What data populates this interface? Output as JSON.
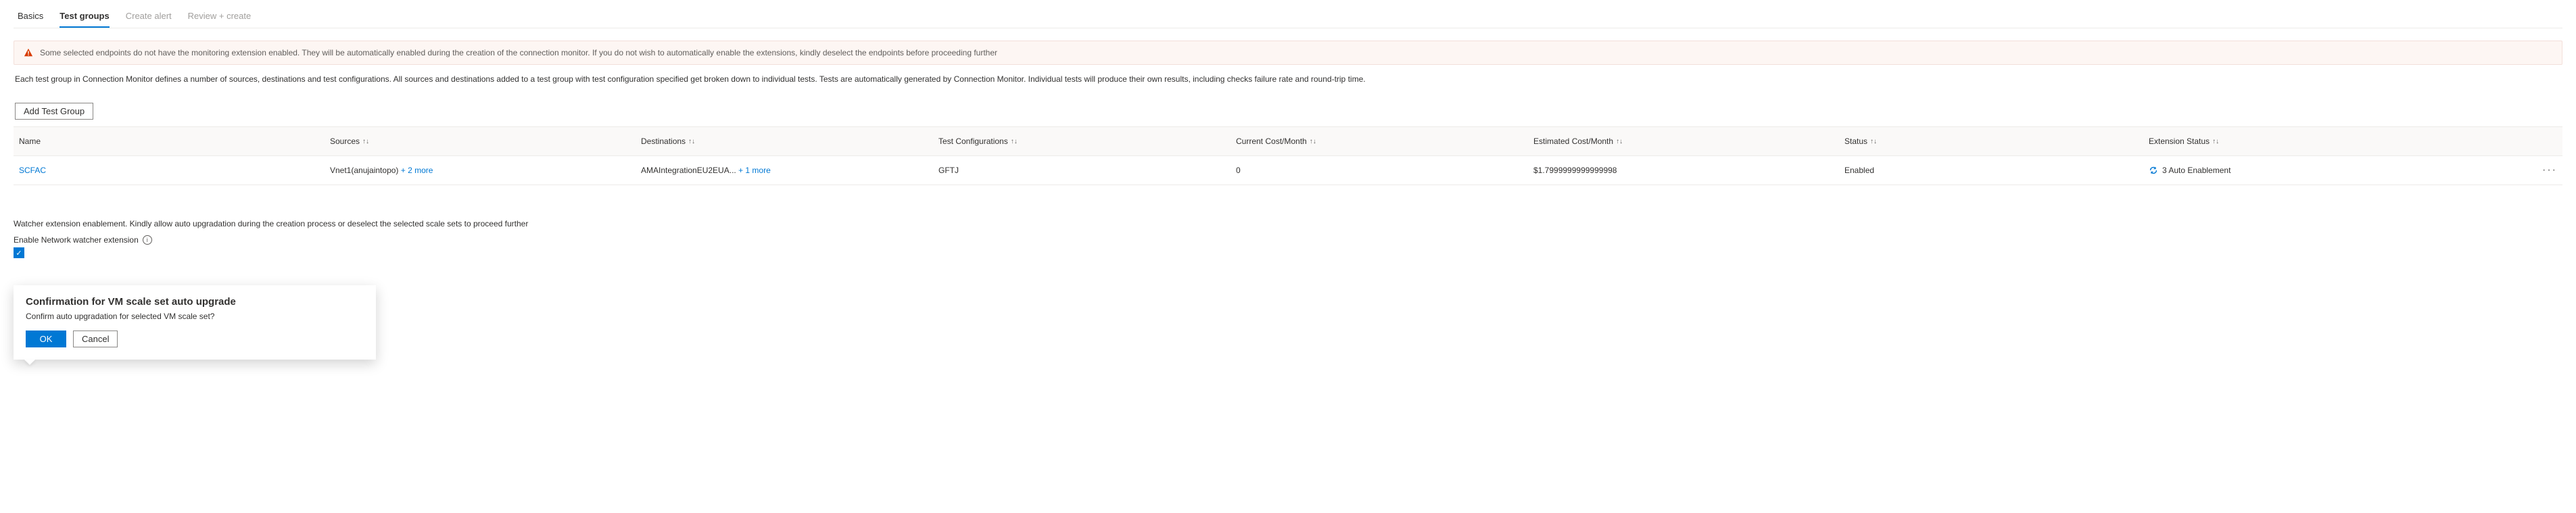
{
  "tabs": {
    "basics": {
      "label": "Basics"
    },
    "test_groups": {
      "label": "Test groups"
    },
    "create_alert": {
      "label": "Create alert"
    },
    "review": {
      "label": "Review + create"
    }
  },
  "warning_bar": {
    "text": "Some selected endpoints do not have the monitoring extension enabled. They will be automatically enabled during the creation of the connection monitor. If you do not wish to automatically enable the extensions, kindly deselect the endpoints before proceeding further"
  },
  "description": "Each test group in Connection Monitor defines a number of sources, destinations and test configurations. All sources and destinations added to a test group with test configuration specified get broken down to individual tests. Tests are automatically generated by Connection Monitor. Individual tests will produce their own results, including checks failure rate and round-trip time.",
  "buttons": {
    "add_test_group": "Add Test Group"
  },
  "columns": {
    "name": "Name",
    "sources": "Sources",
    "dest": "Destinations",
    "testcfg": "Test Configurations",
    "current": "Current Cost/Month",
    "estimated": "Estimated Cost/Month",
    "status": "Status",
    "extstatus": "Extension Status"
  },
  "rows": [
    {
      "name": "SCFAC",
      "sources_main": "Vnet1(anujaintopo)",
      "sources_more": "+ 2 more",
      "dest_main": "AMAIntegrationEU2EUA...",
      "dest_more": "+ 1 more",
      "testcfg": "GFTJ",
      "current": "0",
      "estimated": "$1.7999999999999998",
      "status": "Enabled",
      "extstatus": "3 Auto Enablement"
    }
  ],
  "scale_set_msg": "Watcher extension enablement. Kindly allow auto upgradation during the creation process or deselect the selected scale sets to proceed further",
  "enable_ext_label": "Enable Network watcher extension",
  "dialog": {
    "title": "Confirmation for VM scale set auto upgrade",
    "body": "Confirm auto upgradation for selected VM scale set?",
    "ok": "OK",
    "cancel": "Cancel"
  }
}
